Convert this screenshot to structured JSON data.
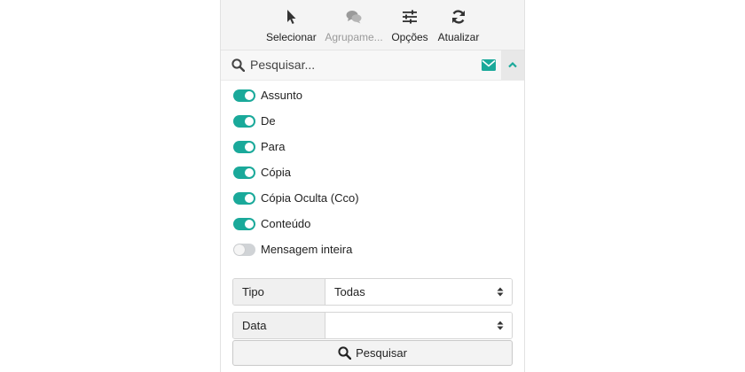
{
  "toolbar": {
    "select_label": "Selecionar",
    "group_label": "Agrupame...",
    "options_label": "Opções",
    "refresh_label": "Atualizar"
  },
  "search": {
    "placeholder": "Pesquisar..."
  },
  "options": [
    {
      "label": "Assunto",
      "enabled": true
    },
    {
      "label": "De",
      "enabled": true
    },
    {
      "label": "Para",
      "enabled": true
    },
    {
      "label": "Cópia",
      "enabled": true
    },
    {
      "label": "Cópia Oculta (Cco)",
      "enabled": true
    },
    {
      "label": "Conteúdo",
      "enabled": true
    },
    {
      "label": "Mensagem inteira",
      "enabled": false
    }
  ],
  "filters": {
    "tipo_label": "Tipo",
    "tipo_value": "Todas",
    "data_label": "Data",
    "data_value": ""
  },
  "submit_label": "Pesquisar",
  "colors": {
    "accent": "#1aa99a",
    "toggle_off": "#d0d3d6"
  },
  "icons": {
    "select": "cursor-arrow-icon",
    "group": "chat-bubbles-icon",
    "options": "sliders-icon",
    "refresh": "refresh-icon",
    "search": "magnifier-icon",
    "mail": "envelope-icon",
    "collapse": "chevron-up-icon",
    "select_arrows": "up-down-arrows-icon"
  }
}
